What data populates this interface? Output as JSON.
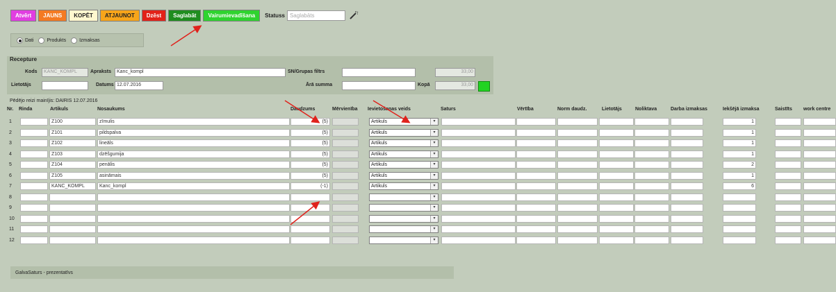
{
  "toolbar": {
    "buttons": [
      {
        "label": "Atvērt",
        "color": "#e13ee1",
        "text": "#ffffff"
      },
      {
        "label": "JAUNS",
        "color": "#f47a22",
        "text": "#ffffff"
      },
      {
        "label": "KOPĒT",
        "color": "#fff8cf",
        "text": "#222222"
      },
      {
        "label": "ATJAUNOT",
        "color": "#f7a51a",
        "text": "#222222"
      },
      {
        "label": "Dzēst",
        "color": "#e22219",
        "text": "#ffffff"
      },
      {
        "label": "Saglabāt",
        "color": "#1f8d1f",
        "text": "#ffffff"
      },
      {
        "label": "Vairumievadīšana",
        "color": "#2fd32f",
        "text": "#ffffff"
      }
    ],
    "status_label": "Statuss",
    "status_value": "Saglabāts"
  },
  "mode": {
    "options": [
      {
        "label": "Dati",
        "selected": true
      },
      {
        "label": "Produkts",
        "selected": false
      },
      {
        "label": "Izmaksas",
        "selected": false
      }
    ]
  },
  "header": {
    "title": "Recepture",
    "kods_label": "Kods",
    "kods_value": "KANC_KOMPL",
    "apraksts_label": "Apraksts",
    "apraksts_value": "Kanc_kompl",
    "sn_label": "SN/Grupas filtrs",
    "sn_value": "",
    "sum1_value": "33,00",
    "lietotajs_label": "Lietotājs",
    "lietotajs_value": "",
    "datums_label": "Datums",
    "datums_value": "12.07.2016",
    "aris_label": "Ārā summa",
    "aris_value": "",
    "kopa_label": "Kopā",
    "kopa_value": "33,00"
  },
  "last_change": "Pēdējo reizi mainījis: DAIRIS 12.07.2016",
  "table": {
    "columns": [
      "Nr.",
      "Rinda",
      "Artikuls",
      "Nosaukums",
      "Daudzums",
      "Mērvienība",
      "Ievietošanas veids",
      "Saturs",
      "Vērtība",
      "Norm daudz.",
      "Lietotājs",
      "Noliktava",
      "Darba izmaksas",
      "Iekšējā izmaksa",
      "Saistīts",
      "work centre"
    ],
    "rows": [
      {
        "nr": "1",
        "artikuls": "Z100",
        "nosaukums": "zīmulis",
        "daudzums": "(5)",
        "veids": "Artikuls",
        "iek": "1"
      },
      {
        "nr": "2",
        "artikuls": "Z101",
        "nosaukums": "pildspalva",
        "daudzums": "(5)",
        "veids": "Artikuls",
        "iek": "1"
      },
      {
        "nr": "3",
        "artikuls": "Z102",
        "nosaukums": "lineāls",
        "daudzums": "(5)",
        "veids": "Artikuls",
        "iek": "1"
      },
      {
        "nr": "4",
        "artikuls": "Z103",
        "nosaukums": "dzēšgumija",
        "daudzums": "(5)",
        "veids": "Artikuls",
        "iek": "1"
      },
      {
        "nr": "5",
        "artikuls": "Z104",
        "nosaukums": "penālis",
        "daudzums": "(5)",
        "veids": "Artikuls",
        "iek": "2"
      },
      {
        "nr": "6",
        "artikuls": "Z105",
        "nosaukums": "asināmais",
        "daudzums": "(5)",
        "veids": "Artikuls",
        "iek": "1"
      },
      {
        "nr": "7",
        "artikuls": "KANC_KOMPL",
        "nosaukums": "Kanc_kompl",
        "daudzums": "(-1)",
        "veids": "Artikuls",
        "iek": "6"
      },
      {
        "nr": "8",
        "artikuls": "",
        "nosaukums": "",
        "daudzums": "",
        "veids": "",
        "iek": ""
      },
      {
        "nr": "9",
        "artikuls": "",
        "nosaukums": "",
        "daudzums": "",
        "veids": "",
        "iek": ""
      },
      {
        "nr": "10",
        "artikuls": "",
        "nosaukums": "",
        "daudzums": "",
        "veids": "",
        "iek": ""
      },
      {
        "nr": "11",
        "artikuls": "",
        "nosaukums": "",
        "daudzums": "",
        "veids": "",
        "iek": ""
      },
      {
        "nr": "12",
        "artikuls": "",
        "nosaukums": "",
        "daudzums": "",
        "veids": "",
        "iek": ""
      }
    ]
  },
  "footer_label": "GalvaSaturs - prezentatīvs",
  "arrow_color": "#e0221c"
}
